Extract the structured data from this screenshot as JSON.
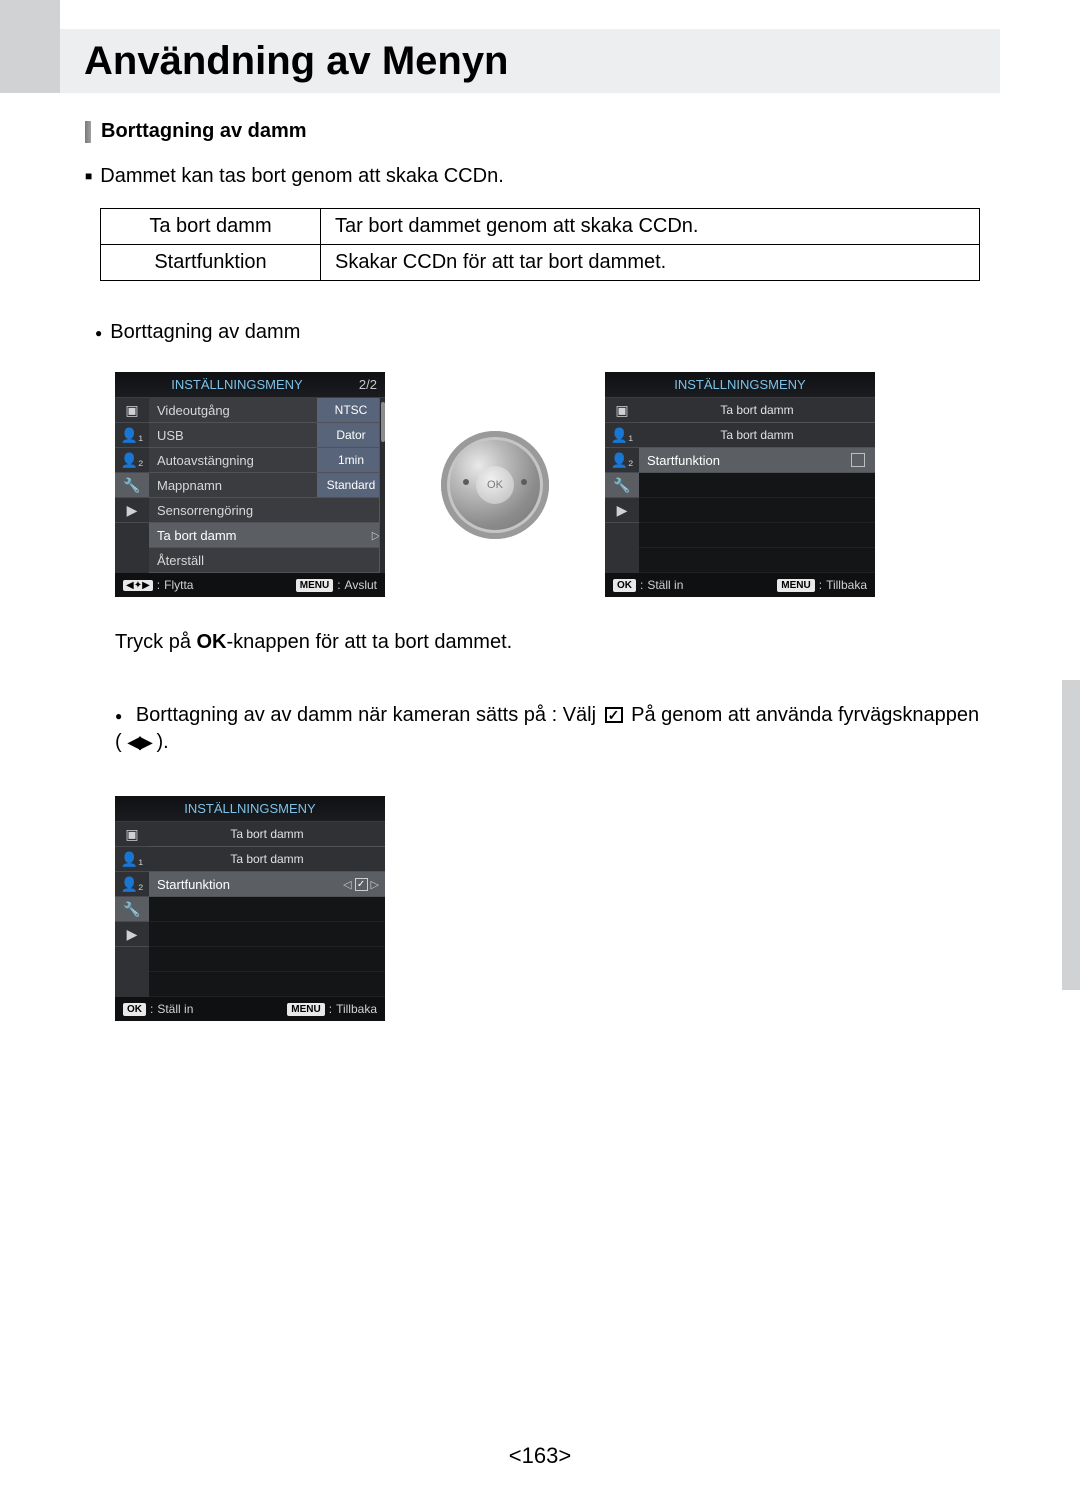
{
  "page_title": "Användning av Menyn",
  "section_title": "Borttagning av damm",
  "intro_text": "Dammet kan tas bort genom att skaka CCDn.",
  "table_rows": [
    {
      "label": "Ta bort damm",
      "desc": "Tar bort dammet genom att skaka CCDn."
    },
    {
      "label": "Startfunktion",
      "desc": "Skakar CCDn för att tar bort dammet."
    }
  ],
  "sub_heading": "Borttagning av damm",
  "caption_ok_prefix": "Tryck på ",
  "caption_ok_bold": "OK",
  "caption_ok_suffix": "-knappen för att ta bort dammet.",
  "para_on_prefix": "Borttagning av av damm när kameran sätts på : Välj ",
  "para_on_suffix": " På genom att använda fyrvägsknappen ( ",
  "para_on_close": " ).",
  "page_number": "<163>",
  "menu1": {
    "header": "INSTÄLLNINGSMENY",
    "page": "2/2",
    "rows": [
      {
        "label": "Videoutgång",
        "value": "NTSC"
      },
      {
        "label": "USB",
        "value": "Dator"
      },
      {
        "label": "Autoavstängning",
        "value": "1min"
      },
      {
        "label": "Mappnamn",
        "value": "Standard"
      },
      {
        "label": "Sensorrengöring",
        "value": ""
      },
      {
        "label": "Ta bort damm",
        "value": "",
        "selected": true,
        "chevron": "▷"
      },
      {
        "label": "Återställ",
        "value": ""
      }
    ],
    "foot_left_icon": "◀✦▶",
    "foot_left": "Flytta",
    "foot_right_btn": "MENU",
    "foot_right": "Avslut"
  },
  "menu2": {
    "header": "INSTÄLLNINGSMENY",
    "sub1": "Ta bort damm",
    "sub2": "Ta bort damm",
    "row_start": "Startfunktion",
    "checkbox_checked": false,
    "foot_left_btn": "OK",
    "foot_left": "Ställ in",
    "foot_right_btn": "MENU",
    "foot_right": "Tillbaka"
  },
  "menu3": {
    "header": "INSTÄLLNINGSMENY",
    "sub1": "Ta bort damm",
    "sub2": "Ta bort damm",
    "row_start": "Startfunktion",
    "foot_left_btn": "OK",
    "foot_left": "Ställ in",
    "foot_right_btn": "MENU",
    "foot_right": "Tillbaka"
  },
  "dial_center": "OK"
}
